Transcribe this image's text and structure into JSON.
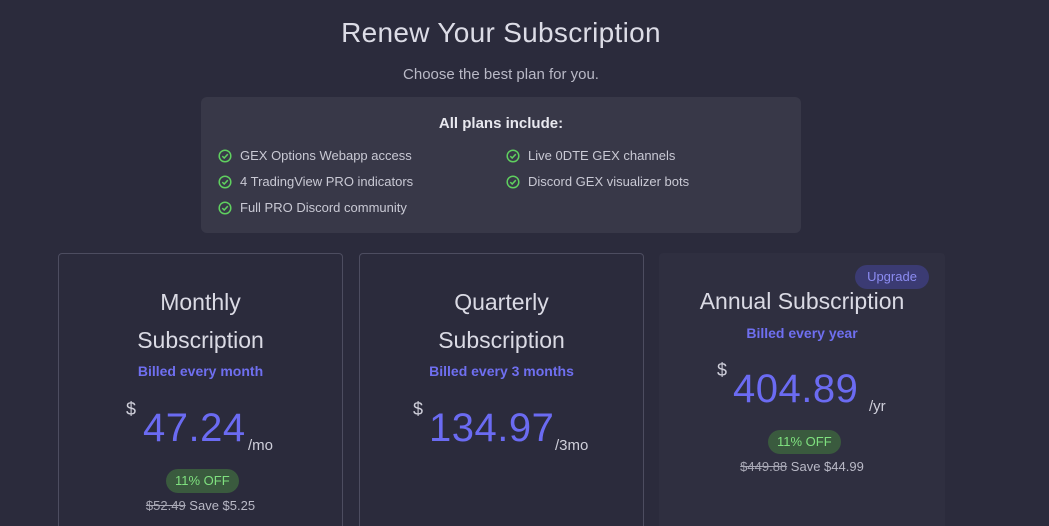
{
  "header": {
    "title": "Renew Your Subscription",
    "subtitle": "Choose the best plan for you."
  },
  "features": {
    "heading": "All plans include:",
    "left": [
      "GEX Options Webapp access",
      "4 TradingView PRO indicators",
      "Full PRO Discord community"
    ],
    "right": [
      "Live 0DTE GEX channels",
      "Discord GEX visualizer bots"
    ],
    "icon": "check-circle-icon"
  },
  "plans": [
    {
      "title_line1": "Monthly",
      "title_line2": "Subscription",
      "billed": "Billed every month",
      "currency": "$",
      "price": "47.24",
      "period": "/mo",
      "discount": "11% OFF",
      "old_price": "$52.49",
      "save_text": "Save $5.25"
    },
    {
      "title_line1": "Quarterly",
      "title_line2": "Subscription",
      "billed": "Billed every 3 months",
      "currency": "$",
      "price": "134.97",
      "period": "/3mo"
    },
    {
      "title_line1": "Annual Subscription",
      "badge": "Upgrade",
      "billed": "Billed every year",
      "currency": "$",
      "price": "404.89",
      "period": "/yr",
      "discount": "11% OFF",
      "old_price": "$449.88",
      "save_text": "Save $44.99"
    }
  ],
  "colors": {
    "background": "#2b2b3c",
    "accent": "#6b6bf2",
    "success": "#7fe07f"
  }
}
